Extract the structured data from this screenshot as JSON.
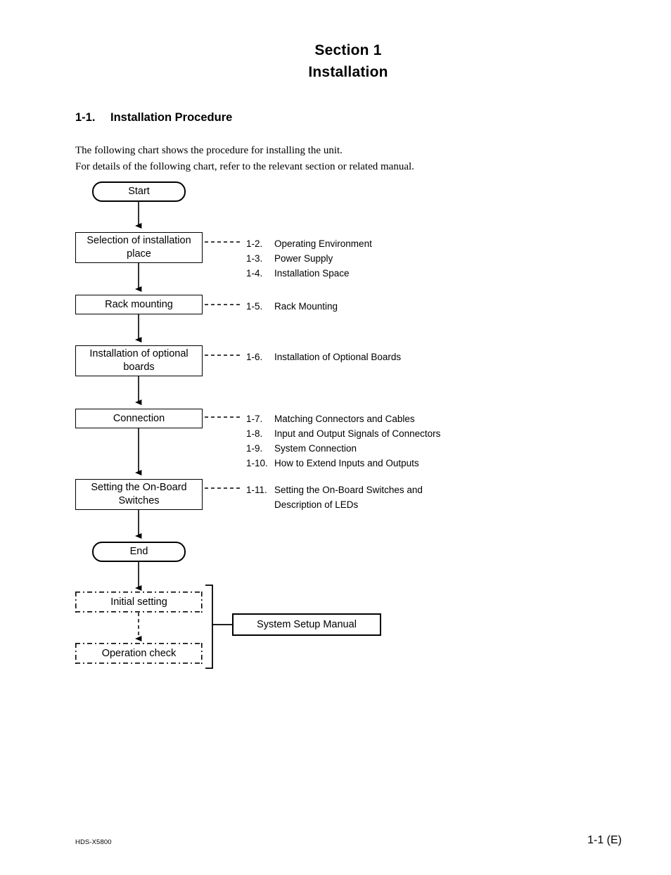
{
  "header": {
    "line1": "Section 1",
    "line2": "Installation"
  },
  "section": {
    "number": "1-1.",
    "title": "Installation Procedure"
  },
  "intro": {
    "line1": "The following chart shows the procedure for installing the unit.",
    "line2": "For details of the following chart, refer to the relevant section or related manual."
  },
  "flow": {
    "nodes": [
      {
        "id": "start",
        "label": "Start"
      },
      {
        "id": "selection",
        "label": "Selection of installation place"
      },
      {
        "id": "rack",
        "label": "Rack mounting"
      },
      {
        "id": "optboards",
        "label": "Installation of optional boards"
      },
      {
        "id": "connection",
        "label": "Connection"
      },
      {
        "id": "switches",
        "label": "Setting the On-Board Switches"
      },
      {
        "id": "end",
        "label": "End"
      },
      {
        "id": "initial",
        "label": "Initial setting"
      },
      {
        "id": "opcheck",
        "label": "Operation check"
      },
      {
        "id": "manual",
        "label": "System Setup Manual"
      }
    ]
  },
  "references": {
    "selection": [
      {
        "num": "1-2.",
        "title": "Operating Environment"
      },
      {
        "num": "1-3.",
        "title": "Power Supply"
      },
      {
        "num": "1-4.",
        "title": "Installation Space"
      }
    ],
    "rack": [
      {
        "num": "1-5.",
        "title": "Rack Mounting"
      }
    ],
    "optboards": [
      {
        "num": "1-6.",
        "title": "Installation of Optional Boards"
      }
    ],
    "connection": [
      {
        "num": "1-7.",
        "title": "Matching Connectors and Cables"
      },
      {
        "num": "1-8.",
        "title": "Input and Output Signals of Connectors"
      },
      {
        "num": "1-9.",
        "title": "System Connection"
      },
      {
        "num": "1-10.",
        "title": "How to Extend Inputs and Outputs"
      }
    ],
    "switches": [
      {
        "num": "1-11.",
        "title": "Setting the On-Board Switches and",
        "cont": "Description of LEDs"
      }
    ]
  },
  "footer": {
    "model": "HDS-X5800",
    "page": "1-1 (E)"
  }
}
